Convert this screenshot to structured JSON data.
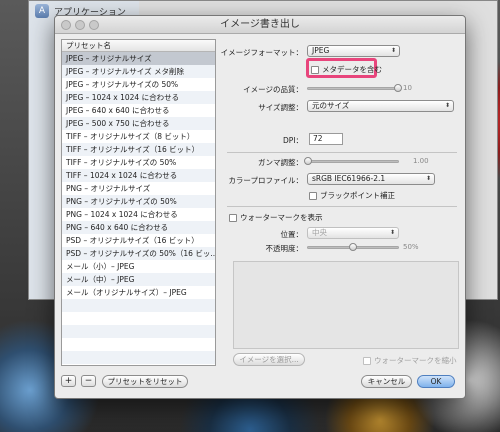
{
  "background_app": {
    "label": "アプリケーション"
  },
  "dialog": {
    "title": "イメージ書き出し",
    "preset_header": "プリセット名",
    "presets": [
      "JPEG – オリジナルサイズ",
      "JPEG – オリジナルサイズ メタ削除",
      "JPEG – オリジナルサイズの 50%",
      "JPEG – 1024 x 1024 に合わせる",
      "JPEG – 640 x 640 に合わせる",
      "JPEG – 500 x 750 に合わせる",
      "TIFF – オリジナルサイズ（8 ビット）",
      "TIFF – オリジナルサイズ（16 ビット）",
      "TIFF – オリジナルサイズの 50%",
      "TIFF – 1024 x 1024 に合わせる",
      "PNG – オリジナルサイズ",
      "PNG – オリジナルサイズの 50%",
      "PNG – 1024 x 1024 に合わせる",
      "PNG – 640 x 640 に合わせる",
      "PSD – オリジナルサイズ（16 ビット）",
      "PSD – オリジナルサイズの 50%（16 ビッ...",
      "メール（小）– JPEG",
      "メール（中）– JPEG",
      "メール（オリジナルサイズ）– JPEG"
    ],
    "selected_preset_index": 0,
    "add_label": "+",
    "remove_label": "−",
    "reset_label": "プリセットをリセット",
    "format_label": "イメージフォーマット：",
    "format_value": "JPEG",
    "metadata_label": "メタデータを含む",
    "quality_label": "イメージの品質：",
    "quality_value": "10",
    "quality_level": 1.0,
    "size_label": "サイズ調整：",
    "size_value": "元のサイズ",
    "dpi_label": "DPI：",
    "dpi_value": "72",
    "gamma_label": "ガンマ調整：",
    "gamma_value": "1.00",
    "gamma_level": 0.0,
    "profile_label": "カラープロファイル：",
    "profile_value": "sRGB IEC61966-2.1",
    "bpc_label": "ブラックポイント補正",
    "watermark_label": "ウォーターマークを表示",
    "position_label": "位置：",
    "position_value": "中央",
    "opacity_label": "不透明度：",
    "opacity_value": "50%",
    "opacity_level": 0.5,
    "choose_image_label": "イメージを選択...",
    "scale_watermark_label": "ウォーターマークを縮小",
    "cancel_label": "キャンセル",
    "ok_label": "OK",
    "highlight_color": "#e8457c"
  }
}
